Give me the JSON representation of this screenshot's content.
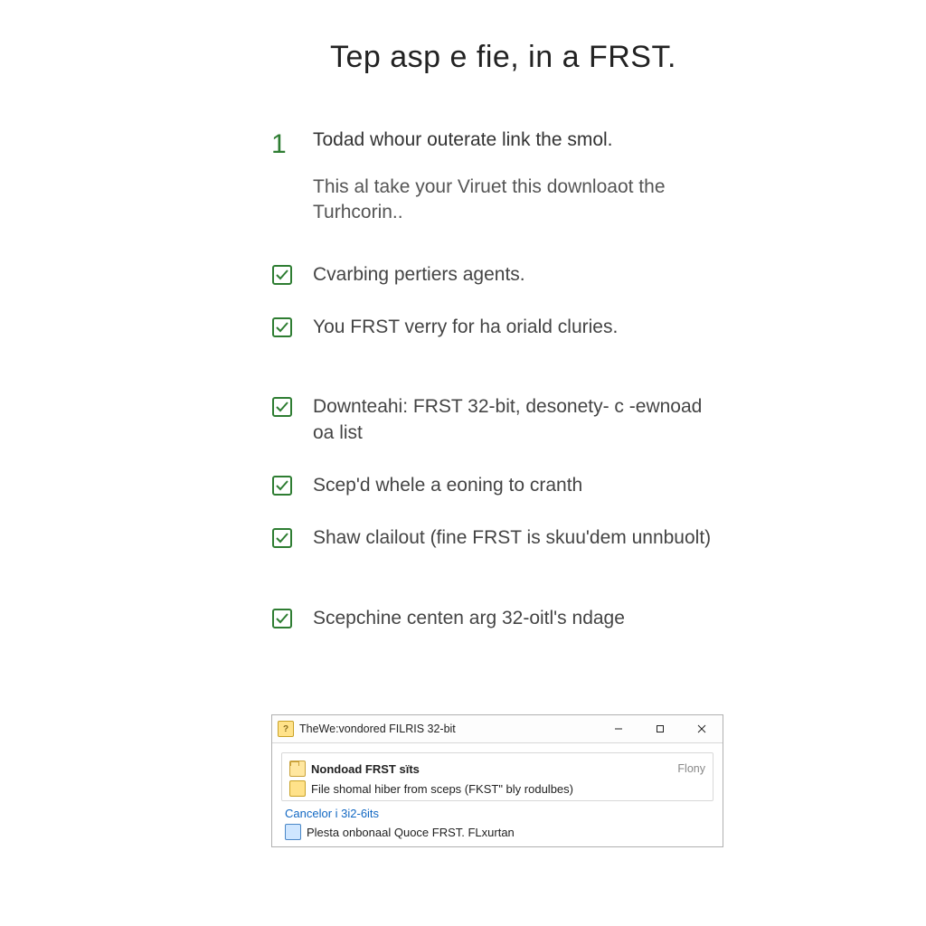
{
  "title": "Tep asp e fie, in a FRST.",
  "step": {
    "number": "1",
    "line1": "Todad whour outerate link the smol.",
    "line2": "This al take your Viruet this downloaot the Turhcorin.."
  },
  "checks": [
    "Cvarbing pertiers agents.",
    "You FRST verry for ha oriald cluries.",
    "Downteahi: FRST 32-bit, desonety- c -ewnoad oa list",
    "Scep'd whele a eoning to cranth",
    "Shaw clailout (fine FRST is skuu'dem unnbuolt)",
    "Scepchine centen arg 32-oitl's ndage"
  ],
  "dialog": {
    "title_icon_glyph": "?",
    "title": "TheWe:vondored FILRIS 32-bit",
    "rows": [
      {
        "icon": "folder",
        "bold": true,
        "text": "Nondoad FRST sïts",
        "right": "Flony"
      },
      {
        "icon": "key",
        "bold": false,
        "text": "File shomal hiber from sceps (FKST\" bly rodulbes)",
        "right": ""
      }
    ],
    "link": "Cancelor i 3i2-6its",
    "bottom": {
      "text": "Plesta onbonaal Quoce FRST. FLxurtan"
    }
  }
}
